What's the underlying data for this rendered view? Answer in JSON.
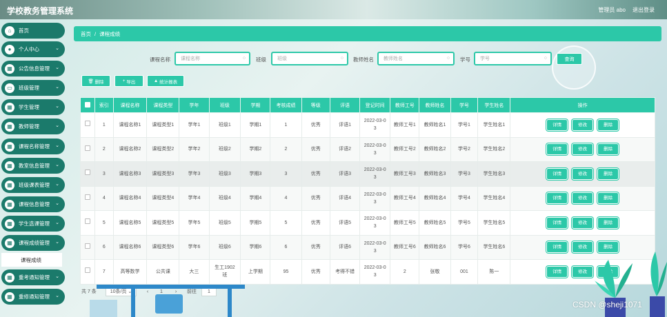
{
  "app": {
    "title": "学校教务管理系统",
    "user": "管理员 abo",
    "logout": "退出登录"
  },
  "sidebar": {
    "items": [
      {
        "label": "首页",
        "icon": "home-icon"
      },
      {
        "label": "个人中心",
        "icon": "user-icon"
      },
      {
        "label": "公告信息管理",
        "icon": "grid-icon"
      },
      {
        "label": "班级管理",
        "icon": "screen-icon"
      },
      {
        "label": "学生管理",
        "icon": "grid-icon"
      },
      {
        "label": "教师管理",
        "icon": "grid-icon"
      },
      {
        "label": "课程名称管理",
        "icon": "grid-icon"
      },
      {
        "label": "教室信息管理",
        "icon": "grid-icon"
      },
      {
        "label": "班级课表管理",
        "icon": "grid-icon"
      },
      {
        "label": "课程信息管理",
        "icon": "grid-icon"
      },
      {
        "label": "学生选课管理",
        "icon": "grid-icon"
      },
      {
        "label": "课程成绩管理",
        "icon": "grid-icon"
      },
      {
        "label": "课程成绩",
        "submenu": true
      },
      {
        "label": "重考通知管理",
        "icon": "grid-icon"
      },
      {
        "label": "重修通知管理",
        "icon": "grid-icon"
      }
    ]
  },
  "breadcrumb": {
    "home": "首页",
    "sep": "/",
    "current": "课程成绩"
  },
  "search": {
    "fields": [
      {
        "label": "课程名称",
        "placeholder": "课程名称"
      },
      {
        "label": "班级",
        "placeholder": "班级"
      },
      {
        "label": "教师姓名",
        "placeholder": "教师姓名"
      },
      {
        "label": "学号",
        "placeholder": "学号"
      }
    ],
    "button": "查询"
  },
  "actions": {
    "delete": "删除",
    "export": "导出",
    "stats": "统计报表"
  },
  "table": {
    "columns": [
      "索引",
      "课程名称",
      "课程类型",
      "学年",
      "班级",
      "学期",
      "考核成绩",
      "等级",
      "评语",
      "登记时间",
      "教师工号",
      "教师姓名",
      "学号",
      "学生姓名",
      "操作"
    ],
    "op_labels": {
      "detail": "详情",
      "edit": "修改",
      "delete": "删除"
    },
    "rows": [
      [
        "1",
        "课程名称1",
        "课程类型1",
        "学年1",
        "班级1",
        "学期1",
        "1",
        "优秀",
        "评语1",
        "2022-03-0\n3",
        "教师工号1",
        "教师姓名1",
        "学号1",
        "学生姓名1"
      ],
      [
        "2",
        "课程名称2",
        "课程类型2",
        "学年2",
        "班级2",
        "学期2",
        "2",
        "优秀",
        "评语2",
        "2022-03-0\n3",
        "教师工号2",
        "教师姓名2",
        "学号2",
        "学生姓名2"
      ],
      [
        "3",
        "课程名称3",
        "课程类型3",
        "学年3",
        "班级3",
        "学期3",
        "3",
        "优秀",
        "评语3",
        "2022-03-0\n3",
        "教师工号3",
        "教师姓名3",
        "学号3",
        "学生姓名3"
      ],
      [
        "4",
        "课程名称4",
        "课程类型4",
        "学年4",
        "班级4",
        "学期4",
        "4",
        "优秀",
        "评语4",
        "2022-03-0\n3",
        "教师工号4",
        "教师姓名4",
        "学号4",
        "学生姓名4"
      ],
      [
        "5",
        "课程名称5",
        "课程类型5",
        "学年5",
        "班级5",
        "学期5",
        "5",
        "优秀",
        "评语5",
        "2022-03-0\n3",
        "教师工号5",
        "教师姓名5",
        "学号5",
        "学生姓名5"
      ],
      [
        "6",
        "课程名称6",
        "课程类型6",
        "学年6",
        "班级6",
        "学期6",
        "6",
        "优秀",
        "评语6",
        "2022-03-0\n3",
        "教师工号6",
        "教师姓名6",
        "学号6",
        "学生姓名6"
      ],
      [
        "7",
        "高等数学",
        "公共课",
        "大三",
        "生工1902\n班",
        "上学期",
        "95",
        "优秀",
        "考得不错",
        "2022-03-0\n3",
        "2",
        "张敬",
        "001",
        "陈一"
      ]
    ]
  },
  "pager": {
    "total": "共 7 条",
    "page_size": "10条/页",
    "prev": "‹",
    "current_page": "1",
    "next": "›",
    "goto_label": "前往",
    "goto_value": "1"
  },
  "watermark": "CSDN @sheji1071",
  "colors": {
    "accent": "#2cc8a8",
    "sidebar": "#1b7a6b"
  }
}
